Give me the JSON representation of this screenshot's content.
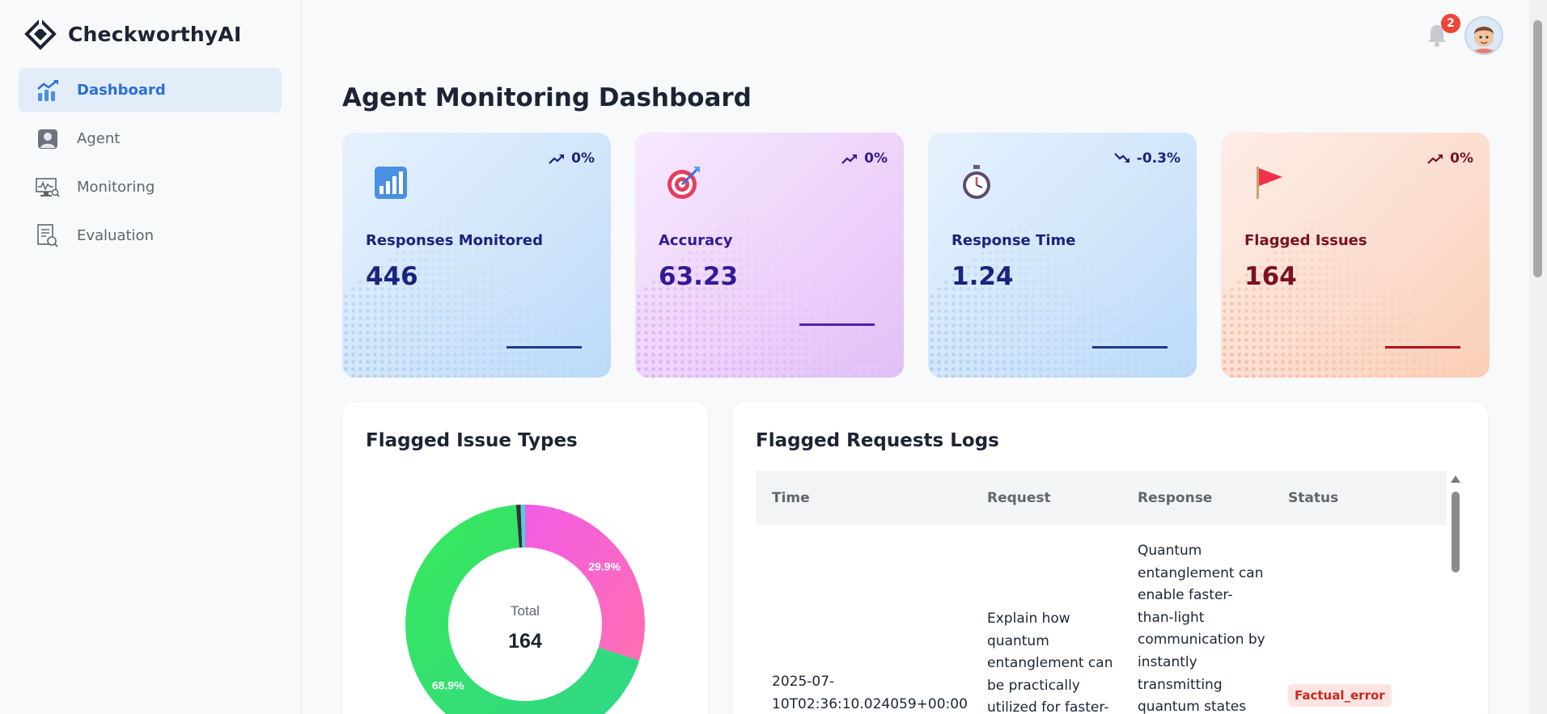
{
  "app": {
    "name": "CheckworthyAI"
  },
  "sidebar": {
    "items": [
      {
        "label": "Dashboard",
        "icon": "chart-trend-icon",
        "active": true
      },
      {
        "label": "Agent",
        "icon": "user-badge-icon",
        "active": false
      },
      {
        "label": "Monitoring",
        "icon": "monitor-search-icon",
        "active": false
      },
      {
        "label": "Evaluation",
        "icon": "report-search-icon",
        "active": false
      }
    ]
  },
  "topbar": {
    "notifications_count": "2",
    "bell_icon": "bell-icon",
    "avatar_icon": "user-avatar-icon"
  },
  "page": {
    "title": "Agent Monitoring Dashboard"
  },
  "stats": [
    {
      "label": "Responses Monitored",
      "value": "446",
      "trend": "0%",
      "trend_dir": "up",
      "icon": "bar-chart-icon",
      "color": "#1a237e"
    },
    {
      "label": "Accuracy",
      "value": "63.23",
      "trend": "0%",
      "trend_dir": "up",
      "icon": "target-icon",
      "color": "#311b92"
    },
    {
      "label": "Response Time",
      "value": "1.24",
      "trend": "-0.3%",
      "trend_dir": "down",
      "icon": "stopwatch-icon",
      "color": "#1a237e"
    },
    {
      "label": "Flagged Issues",
      "value": "164",
      "trend": "0%",
      "trend_dir": "up",
      "icon": "flag-icon",
      "color": "#7b1122"
    }
  ],
  "issue_types": {
    "title": "Flagged Issue Types",
    "center_label": "Total",
    "center_value": "164",
    "slices": [
      {
        "value": 29.9,
        "label": "29.9%",
        "color": "#f25ce6"
      },
      {
        "value": 68.9,
        "label": "68.9%",
        "color": "#2ee86c"
      },
      {
        "value": 0.6,
        "label": "",
        "color": "#333333"
      },
      {
        "value": 0.6,
        "label": "",
        "color": "#4dd0e1"
      }
    ]
  },
  "logs": {
    "title": "Flagged Requests Logs",
    "columns": [
      "Time",
      "Request",
      "Response",
      "Status"
    ],
    "rows": [
      {
        "time": "2025-07-10T02:36:10.024059+00:00",
        "request": "Explain how quantum entanglement can be practically utilized for faster-",
        "response": "Quantum entanglement can enable faster-than-light communication by instantly transmitting quantum states",
        "status": "Factual_error"
      }
    ]
  }
}
